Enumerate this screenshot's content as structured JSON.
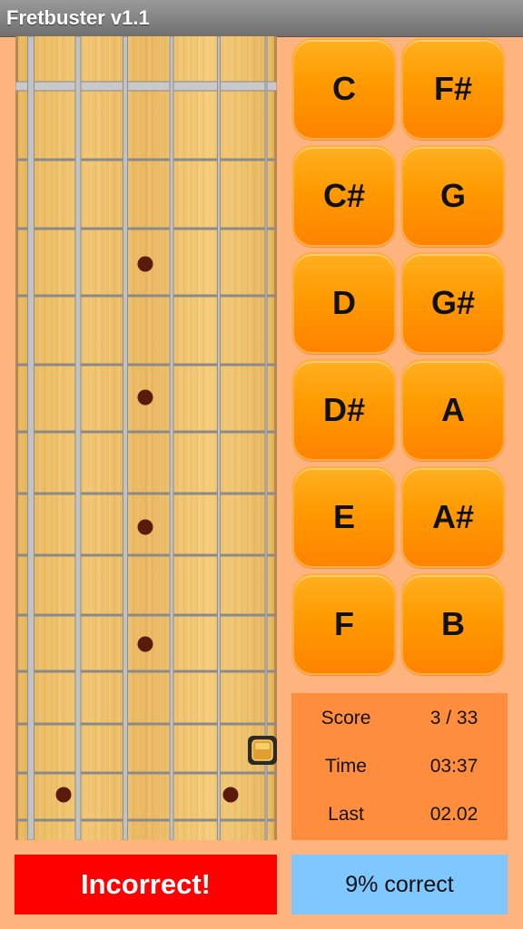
{
  "app": {
    "title": "Fretbuster v1.1"
  },
  "notes": [
    "C",
    "F#",
    "C#",
    "G",
    "D",
    "G#",
    "D#",
    "A",
    "E",
    "A#",
    "F",
    "B"
  ],
  "stats": {
    "score_label": "Score",
    "score_value": "3 / 33",
    "time_label": "Time",
    "time_value": "03:37",
    "last_label": "Last",
    "last_value": "02.02"
  },
  "feedback": {
    "result": "Incorrect!",
    "percent": "9% correct"
  },
  "colors": {
    "background": "#ffb37f",
    "button": "#ff9a00",
    "stats_panel": "#ff8d3e",
    "incorrect": "#ff0000",
    "percent_panel": "#7fc7ff"
  }
}
